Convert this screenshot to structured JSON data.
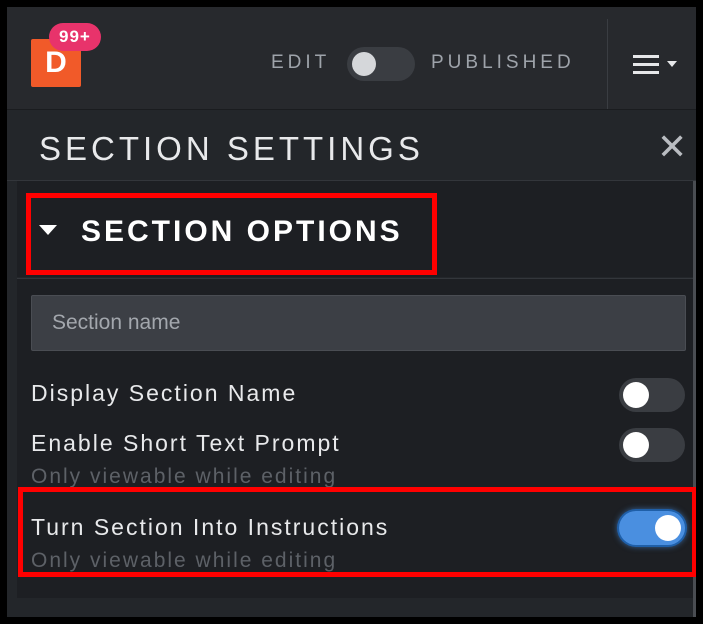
{
  "topbar": {
    "logo_letter": "D",
    "notification_count": "99+",
    "edit_label": "EDIT",
    "published_label": "PUBLISHED",
    "mode_toggle_on": false,
    "menu_icon": "hamburger-menu-icon"
  },
  "settings": {
    "title": "SECTION SETTINGS",
    "close_icon": "close-icon"
  },
  "section_options": {
    "title": "SECTION OPTIONS",
    "expanded": true,
    "name_placeholder": "Section name",
    "name_value": "",
    "options": [
      {
        "label": "Display Section Name",
        "sublabel": "",
        "enabled": false
      },
      {
        "label": "Enable Short Text Prompt",
        "sublabel": "Only viewable while editing",
        "enabled": false
      },
      {
        "label": "Turn Section Into Instructions",
        "sublabel": "Only viewable while editing",
        "enabled": true
      }
    ]
  },
  "colors": {
    "brand_orange": "#f15a29",
    "badge_pink": "#e8336b",
    "toggle_on_blue": "#4a8fe0",
    "highlight_red": "#ff0000"
  }
}
